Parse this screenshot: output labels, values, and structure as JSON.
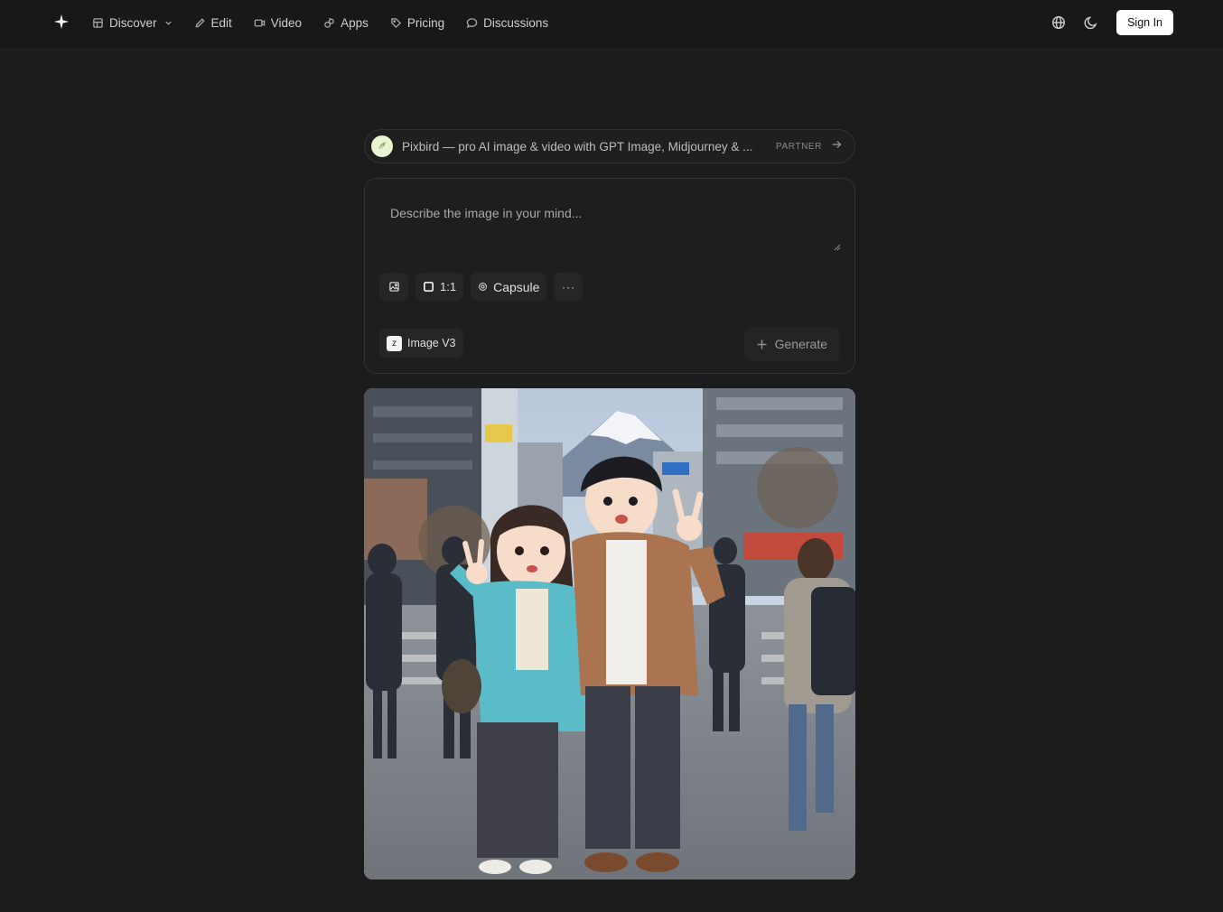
{
  "nav": {
    "items": [
      {
        "label": "Discover",
        "icon": "discover-icon",
        "has_dropdown": true
      },
      {
        "label": "Edit",
        "icon": "pencil-icon"
      },
      {
        "label": "Video",
        "icon": "video-icon"
      },
      {
        "label": "Apps",
        "icon": "apps-icon"
      },
      {
        "label": "Pricing",
        "icon": "tag-icon"
      },
      {
        "label": "Discussions",
        "icon": "chat-bubble-icon"
      }
    ],
    "sign_in_label": "Sign In"
  },
  "partner_banner": {
    "text": "Pixbird — pro AI image & video with GPT Image, Midjourney & ...",
    "tag": "PARTNER"
  },
  "composer": {
    "placeholder": "Describe the image in your mind...",
    "aspect_ratio": "1:1",
    "style": "Capsule",
    "more_label": "···",
    "model": {
      "badge": "z",
      "name": "Image V3"
    },
    "generate_label": "Generate"
  },
  "colors": {
    "background": "#1c1c1c",
    "topbar": "#181818",
    "sign_in_bg": "#ffffff"
  }
}
